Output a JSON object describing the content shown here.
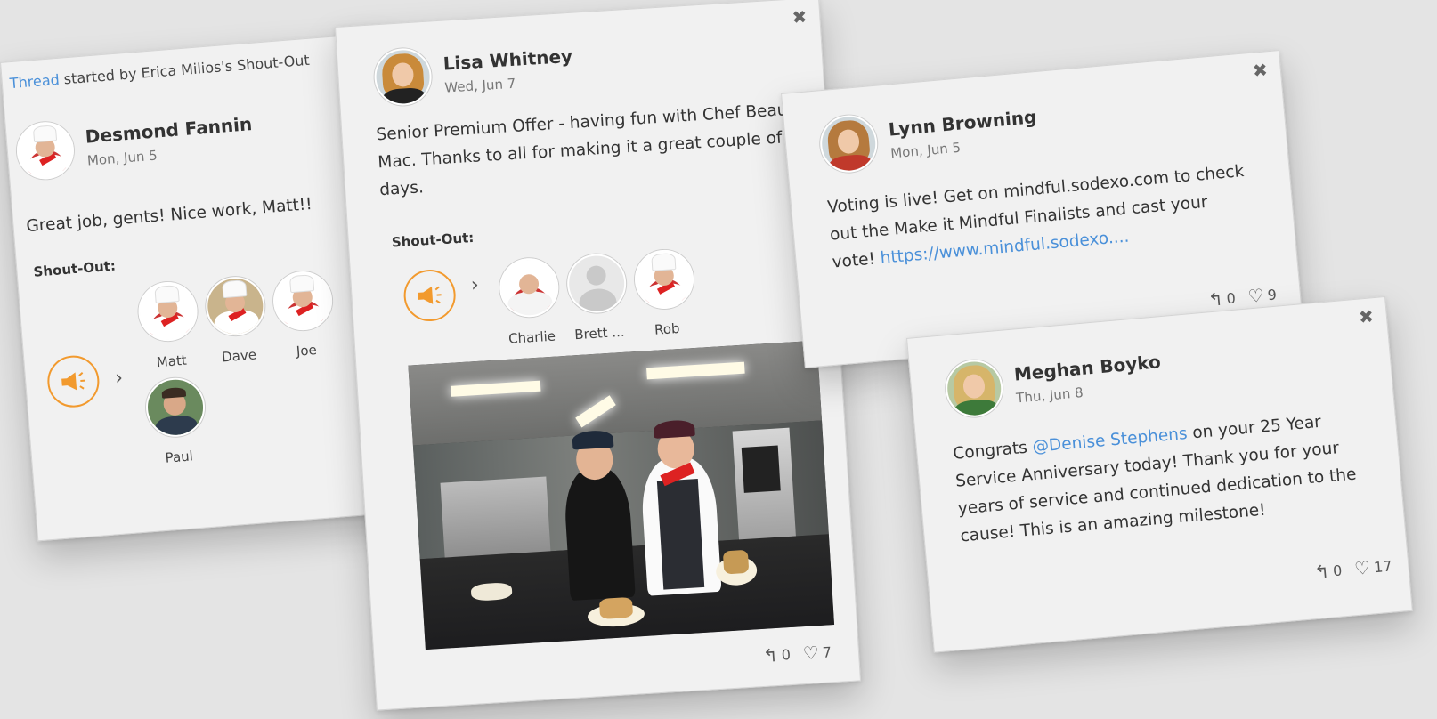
{
  "cards": {
    "desmond": {
      "thread_link": "Thread",
      "thread_rest": " started by Erica Milios's Shout-Out",
      "name": "Desmond Fannin",
      "date": "Mon, Jun 5",
      "body": "Great job, gents! Nice work, Matt!!",
      "shout_label": "Shout-Out:",
      "people": [
        "Matt",
        "Dave",
        "Joe",
        "Paul"
      ]
    },
    "lisa": {
      "close": "✖",
      "name": "Lisa Whitney",
      "date": "Wed, Jun 7",
      "body": "Senior Premium Offer - having fun with Chef Beau Mac. Thanks to all for making it a great couple of days.",
      "shout_label": "Shout-Out:",
      "people": [
        "Charlie",
        "Brett ...",
        "Rob"
      ],
      "replies": "0",
      "likes": "7"
    },
    "lynn": {
      "close": "✖",
      "name": "Lynn Browning",
      "date": "Mon, Jun 5",
      "body": "Voting is live! Get on mindful.sodexo.com to check out the Make it Mindful Finalists and cast your vote! ",
      "link": "https://www.mindful.sodexo....",
      "replies": "0",
      "likes": "9"
    },
    "meghan": {
      "close": "✖",
      "name": "Meghan Boyko",
      "date": "Thu, Jun 8",
      "body_pre": "Congrats ",
      "mention": "@Denise Stephens",
      "body_post": " on your 25 Year Service Anniversary today! Thank you for your years of service and continued dedication to the cause! This is an amazing milestone!",
      "replies": "0",
      "likes": "17"
    }
  },
  "icons": {
    "reply": "↰",
    "like": "♡",
    "arrow": "›"
  },
  "colors": {
    "accent_orange": "#f29a2e",
    "link_blue": "#4a90d9"
  }
}
